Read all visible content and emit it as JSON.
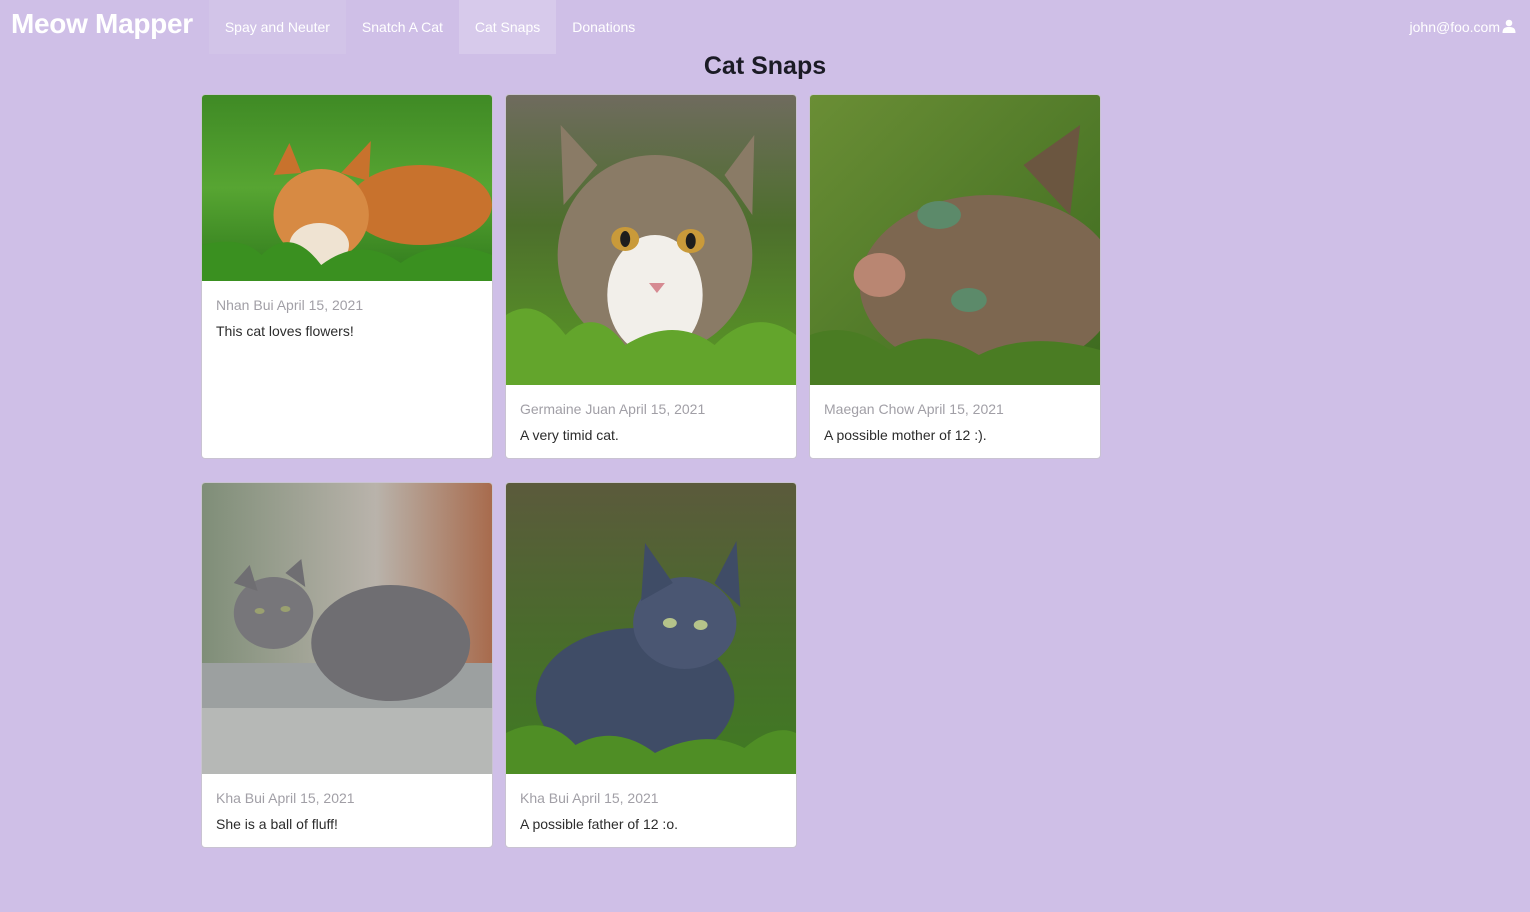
{
  "nav": {
    "brand": "Meow Mapper",
    "items": [
      {
        "label": "Spay and Neuter"
      },
      {
        "label": "Snatch A Cat"
      },
      {
        "label": "Cat Snaps"
      },
      {
        "label": "Donations"
      }
    ],
    "user_email": "john@foo.com"
  },
  "page": {
    "title": "Cat Snaps"
  },
  "snaps": [
    {
      "author": "Nhan Bui",
      "date": "April 15, 2021",
      "caption": "This cat loves flowers!"
    },
    {
      "author": "Germaine Juan",
      "date": "April 15, 2021",
      "caption": "A very timid cat."
    },
    {
      "author": "Maegan Chow",
      "date": "April 15, 2021",
      "caption": "A possible mother of 12 :)."
    },
    {
      "author": "Kha Bui",
      "date": "April 15, 2021",
      "caption": "She is a ball of fluff!"
    },
    {
      "author": "Kha Bui",
      "date": "April 15, 2021",
      "caption": "A possible father of 12 :o."
    }
  ],
  "colors": {
    "background": "#cfbfe7",
    "card": "#ffffff",
    "meta_text": "#a19fa6"
  }
}
